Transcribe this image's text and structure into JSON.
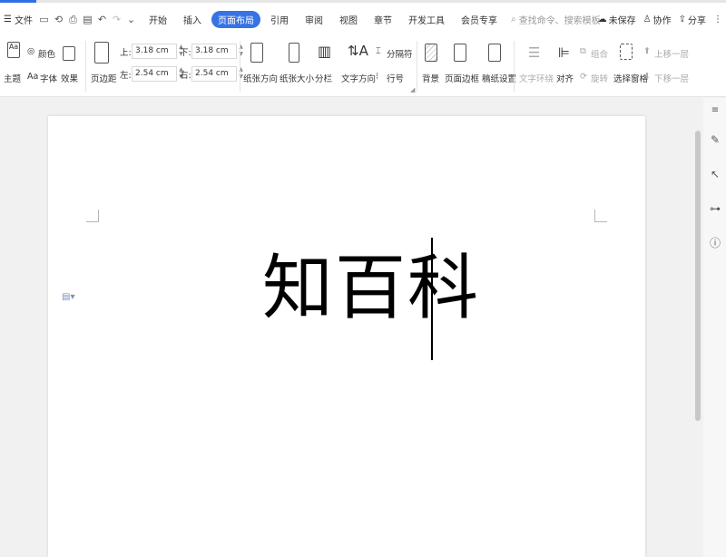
{
  "menubar": {
    "file_label": "文件",
    "tabs": [
      {
        "label": "开始",
        "active": false
      },
      {
        "label": "插入",
        "active": false
      },
      {
        "label": "页面布局",
        "active": true
      },
      {
        "label": "引用",
        "active": false
      },
      {
        "label": "审阅",
        "active": false
      },
      {
        "label": "视图",
        "active": false
      },
      {
        "label": "章节",
        "active": false
      },
      {
        "label": "开发工具",
        "active": false
      },
      {
        "label": "会员专享",
        "active": false
      }
    ],
    "search_placeholder": "查找命令、搜索模板",
    "unsaved_label": "未保存",
    "collab_label": "协作",
    "share_label": "分享"
  },
  "ribbon": {
    "theme_label": "主题",
    "color_label": "颜色",
    "font_label": "字体",
    "effect_label": "效果",
    "margins_label": "页边距",
    "top_label": "上:",
    "top_value": "3.18 cm",
    "bottom_label": "下:",
    "bottom_value": "3.18 cm",
    "left_label": "左:",
    "left_value": "2.54 cm",
    "right_label": "右:",
    "right_value": "2.54 cm",
    "orientation_label": "纸张方向",
    "size_label": "纸张大小",
    "columns_label": "分栏",
    "text_direction_label": "文字方向",
    "separator_label": "分隔符",
    "line_number_label": "行号",
    "background_label": "背景",
    "border_label": "页面边框",
    "manuscript_label": "稿纸设置",
    "wrap_label": "文字环绕",
    "align_label": "对齐",
    "group_label": "组合",
    "rotate_label": "旋转",
    "selection_pane_label": "选择窗格",
    "bring_forward_label": "上移一层",
    "send_backward_label": "下移一层"
  },
  "document": {
    "text": "知百科"
  },
  "colors": {
    "accent": "#3773e4"
  }
}
